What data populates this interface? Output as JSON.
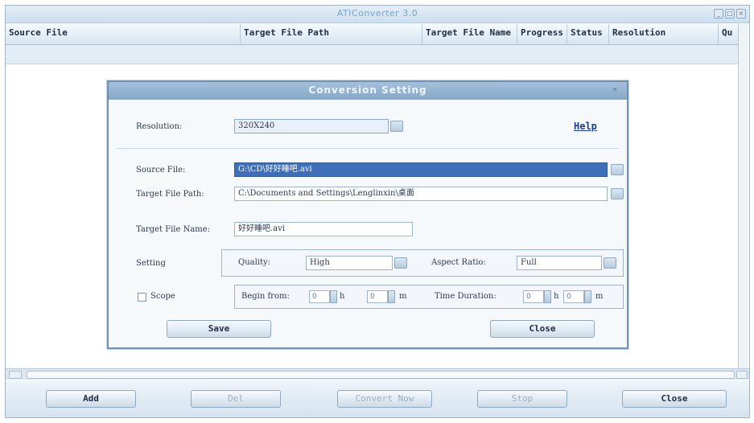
{
  "app": {
    "title": "ATIConverter 3.0",
    "window_controls": [
      "_",
      "□",
      "×"
    ]
  },
  "table": {
    "columns": [
      "Source File",
      "Target File Path",
      "Target File Name",
      "Progress",
      "Status",
      "Resolution",
      "Qu"
    ]
  },
  "toolbar": {
    "buttons": [
      {
        "label": "Add",
        "enabled": true
      },
      {
        "label": "Del",
        "enabled": false
      },
      {
        "label": "Convert Now",
        "enabled": false
      },
      {
        "label": "Stop",
        "enabled": false
      },
      {
        "label": "Close",
        "enabled": true
      }
    ]
  },
  "dialog": {
    "title": "Conversion Setting",
    "close_glyph": "×",
    "resolution_label": "Resolution:",
    "resolution_value": "320X240",
    "help_label": "Help",
    "source_label": "Source File:",
    "source_value": "G:\\CD\\好好睡吧.avi",
    "target_path_label": "Target File Path:",
    "target_path_value": "C:\\Documents and Settings\\Lenglinxin\\桌面",
    "target_name_label": "Target File Name:",
    "target_name_value": "好好睡吧.avi",
    "setting_label": "Setting",
    "quality_label": "Quality:",
    "quality_value": "High",
    "aspect_label": "Aspect Ratio:",
    "aspect_value": "Full",
    "scope_label": "Scope",
    "begin_label": "Begin from:",
    "begin_h": "0",
    "h_unit": "h",
    "begin_m": "0",
    "m_unit": "m",
    "duration_label": "Time Duration:",
    "duration_h": "0",
    "duration_m": "0",
    "save_label": "Save",
    "close_label": "Close"
  },
  "colors": {
    "accent": "#86a7c8",
    "selection": "#3f6fb8",
    "link": "#1d3f8a"
  }
}
